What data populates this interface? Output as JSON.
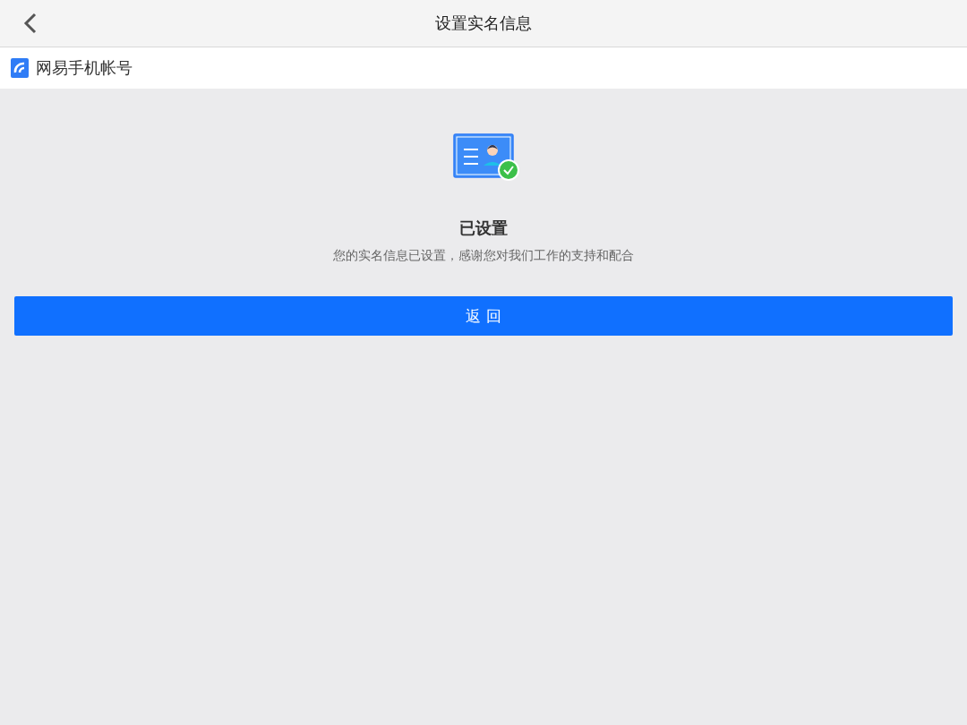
{
  "nav_bar": {
    "title": "设置实名信息"
  },
  "brand_bar": {
    "name": "网易手机帐号"
  },
  "result": {
    "title": "已设置",
    "message": "您的实名信息已设置，感谢您对我们工作的支持和配合"
  },
  "buttons": [
    "返 回"
  ]
}
